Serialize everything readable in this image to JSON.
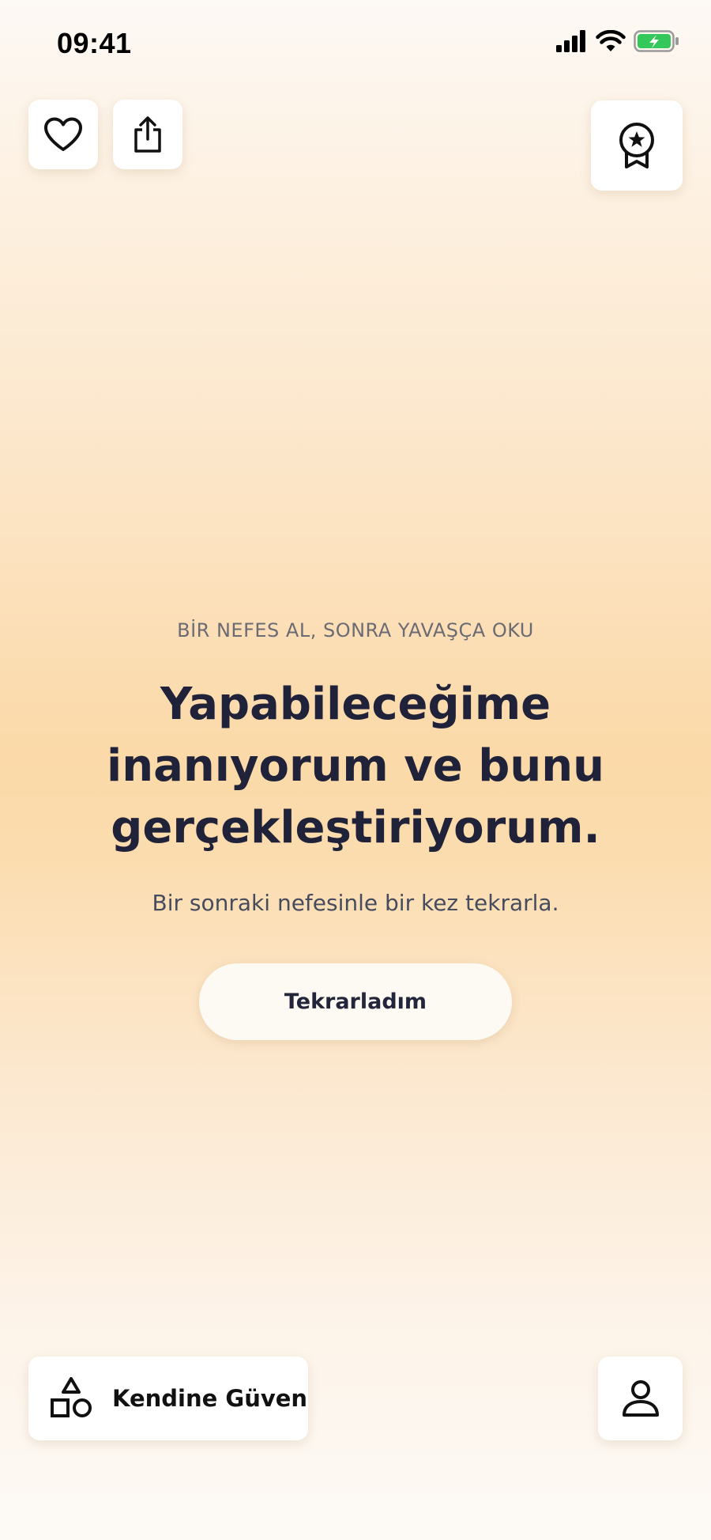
{
  "status_bar": {
    "time": "09:41",
    "icons": [
      "cellular-signal-icon",
      "wifi-icon",
      "battery-charging-icon"
    ]
  },
  "top_actions": {
    "favorite_icon": "heart-icon",
    "share_icon": "share-icon",
    "award_icon": "award-ribbon-icon"
  },
  "affirmation": {
    "eyebrow": "BİR NEFES AL, SONRA YAVAŞÇA OKU",
    "text": "Yapabileceğime inanıyorum ve bunu gerçekleştiriyorum.",
    "instruction": "Bir sonraki nefesinle bir kez tekrarla.",
    "button_label": "Tekrarladım"
  },
  "bottom_bar": {
    "category_label": "Kendine Güven",
    "category_icon": "shapes-icon",
    "profile_icon": "user-icon"
  },
  "colors": {
    "text_primary": "#1f2239",
    "text_secondary": "#6b6b74",
    "background_peach": "#fbd9a8",
    "battery_green": "#34c759"
  }
}
